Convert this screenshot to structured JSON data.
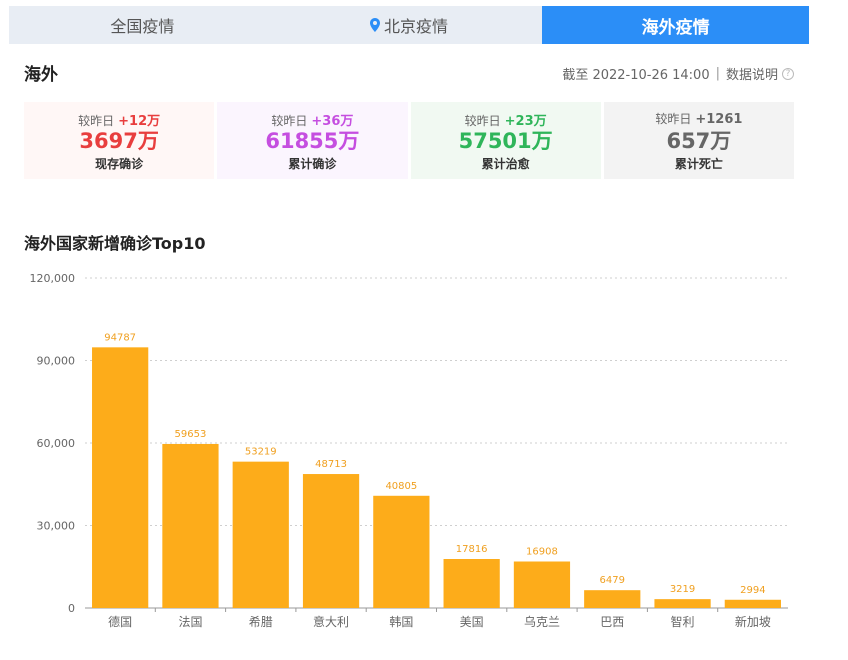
{
  "tabs": [
    {
      "label": "全国疫情",
      "active": false
    },
    {
      "label": "北京疫情",
      "active": false
    },
    {
      "label": "海外疫情",
      "active": true
    }
  ],
  "header": {
    "title": "海外",
    "deadline": "截至 2022-10-26 14:00",
    "explain": "数据说明"
  },
  "cards": [
    {
      "delta_prefix": "较昨日",
      "delta": "+12万",
      "value": "3697万",
      "label": "现存确诊",
      "color": "#e83e3e",
      "bg": "#fff7f6"
    },
    {
      "delta_prefix": "较昨日",
      "delta": "+36万",
      "value": "61855万",
      "label": "累计确诊",
      "color": "#c54ee0",
      "bg": "#fbf5fe"
    },
    {
      "delta_prefix": "较昨日",
      "delta": "+23万",
      "value": "57501万",
      "label": "累计治愈",
      "color": "#2fb55a",
      "bg": "#f1f9f2"
    },
    {
      "delta_prefix": "较昨日",
      "delta": "+1261",
      "value": "657万",
      "label": "累计死亡",
      "color": "#666666",
      "bg": "#f3f3f3"
    }
  ],
  "chart_title": "海外国家新增确诊Top10",
  "chart_data": {
    "type": "bar",
    "categories": [
      "德国",
      "法国",
      "希腊",
      "意大利",
      "韩国",
      "美国",
      "乌克兰",
      "巴西",
      "智利",
      "新加坡"
    ],
    "values": [
      94787,
      59653,
      53219,
      48713,
      40805,
      17816,
      16908,
      6479,
      3219,
      2994
    ],
    "ylim": [
      0,
      120000
    ],
    "yticks": [
      "0",
      "30,000",
      "60,000",
      "90,000",
      "120,000"
    ],
    "ytick_values": [
      0,
      30000,
      60000,
      90000,
      120000
    ],
    "bar_color": "#fdac1a",
    "grid": true
  }
}
